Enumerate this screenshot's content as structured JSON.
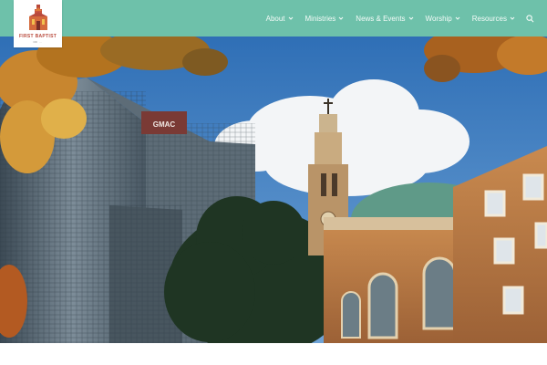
{
  "header": {
    "background": "#6ec1aa",
    "logo": {
      "name_line1": "FIRST BAPTIST",
      "name_line2": "OF ...",
      "accent": "#b94a3c"
    },
    "nav": [
      {
        "label": "About",
        "icon": "chevron-down-icon"
      },
      {
        "label": "Ministries",
        "icon": "chevron-down-icon"
      },
      {
        "label": "News & Events",
        "icon": "chevron-down-icon"
      },
      {
        "label": "Worship",
        "icon": "chevron-down-icon"
      },
      {
        "label": "Resources",
        "icon": "chevron-down-icon"
      }
    ],
    "search_icon": "search-icon"
  },
  "hero": {
    "sign_text": "GMAC"
  }
}
